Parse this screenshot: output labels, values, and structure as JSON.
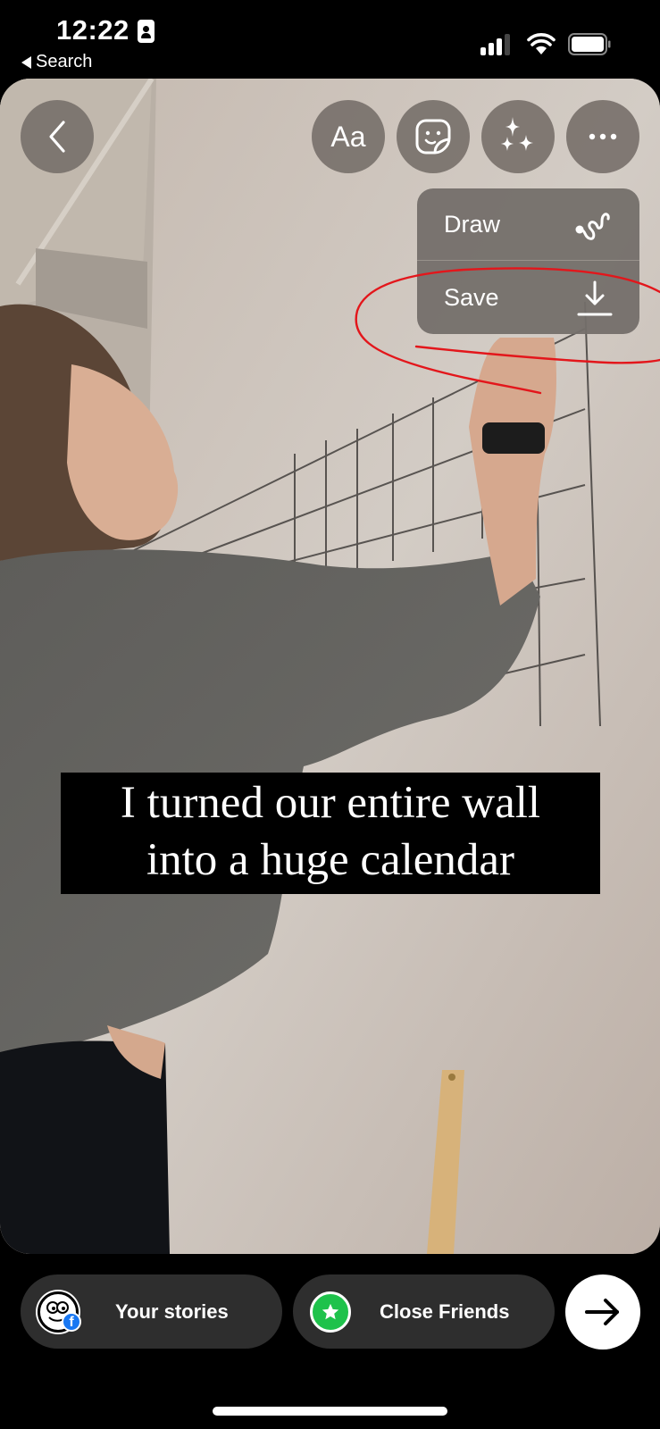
{
  "status_bar": {
    "time": "12:22",
    "back_app_label": "Search",
    "icons": [
      "person-id-icon",
      "cellular-signal-icon",
      "wifi-icon",
      "battery-icon"
    ]
  },
  "story_editor": {
    "top_controls": [
      {
        "id": "back",
        "icon": "chevron-left-icon"
      },
      {
        "id": "text",
        "label": "Aa",
        "icon": "text-icon"
      },
      {
        "id": "sticker",
        "icon": "sticker-icon"
      },
      {
        "id": "effects",
        "icon": "sparkles-icon"
      },
      {
        "id": "more",
        "icon": "more-horizontal-icon"
      }
    ],
    "more_menu": {
      "items": [
        {
          "label": "Draw",
          "icon": "draw-squiggle-icon"
        },
        {
          "label": "Save",
          "icon": "download-icon"
        }
      ]
    },
    "caption": {
      "line1": "I turned our entire wall",
      "line2": "into a huge calendar"
    },
    "annotation": {
      "type": "hand-drawn circle",
      "color": "#e3161b",
      "circles_item": "Save"
    }
  },
  "share_bar": {
    "your_stories_label": "Your stories",
    "close_friends_label": "Close Friends",
    "close_friends_color": "#1ec24b",
    "facebook_badge": "f",
    "next_icon": "arrow-right-icon"
  }
}
